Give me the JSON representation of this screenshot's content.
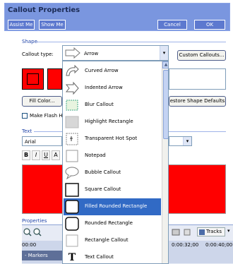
{
  "header": {
    "title": "Callout Properties",
    "assist_label": "Assist Me",
    "show_label": "Show Me",
    "cancel_label": "Cancel",
    "ok_label": "OK"
  },
  "shape": {
    "group_label": "Shape",
    "callout_type_label": "Callout type:",
    "selected_type": "Arrow",
    "custom_callouts_label": "Custom Callouts...",
    "fill_color_label": "Fill Color...",
    "restore_label": "estore Shape Defaults",
    "make_flash_label": "Make Flash Hot"
  },
  "text": {
    "group_label": "Text",
    "font": "Arial",
    "bold": "B",
    "italic": "I",
    "underline": "U",
    "font_color": "A"
  },
  "properties": {
    "group_label": "Properties"
  },
  "timeline": {
    "markers_label": "- Markers",
    "tracks_label": "Tracks",
    "time_0": "0:00:32;00",
    "time_1": "0:00:40;00",
    "time_partial": "00:00"
  },
  "dropdown": {
    "items": [
      {
        "label": "Curved Arrow",
        "icon": "curved-arrow-icon"
      },
      {
        "label": "Indented Arrow",
        "icon": "indented-arrow-icon"
      },
      {
        "label": "Blur Callout",
        "icon": "blur-callout-icon"
      },
      {
        "label": "Highlight Rectangle",
        "icon": "highlight-rectangle-icon"
      },
      {
        "label": "Transparent Hot Spot",
        "icon": "hot-spot-icon"
      },
      {
        "label": "Notepad",
        "icon": "notepad-icon"
      },
      {
        "label": "Bubble Callout",
        "icon": "bubble-callout-icon"
      },
      {
        "label": "Square Callout",
        "icon": "square-callout-icon"
      },
      {
        "label": "Filled Rounded Rectangle",
        "icon": "filled-rounded-rectangle-icon",
        "selected": true
      },
      {
        "label": "Rounded Rectangle",
        "icon": "rounded-rectangle-icon"
      },
      {
        "label": "Rectangle Callout",
        "icon": "rectangle-callout-icon"
      },
      {
        "label": "Text Callout",
        "icon": "text-callout-icon",
        "glyph": "T"
      }
    ]
  },
  "colors": {
    "header_bg": "#7a96df",
    "selection": "#316ac5",
    "fill": "#ff0000"
  }
}
